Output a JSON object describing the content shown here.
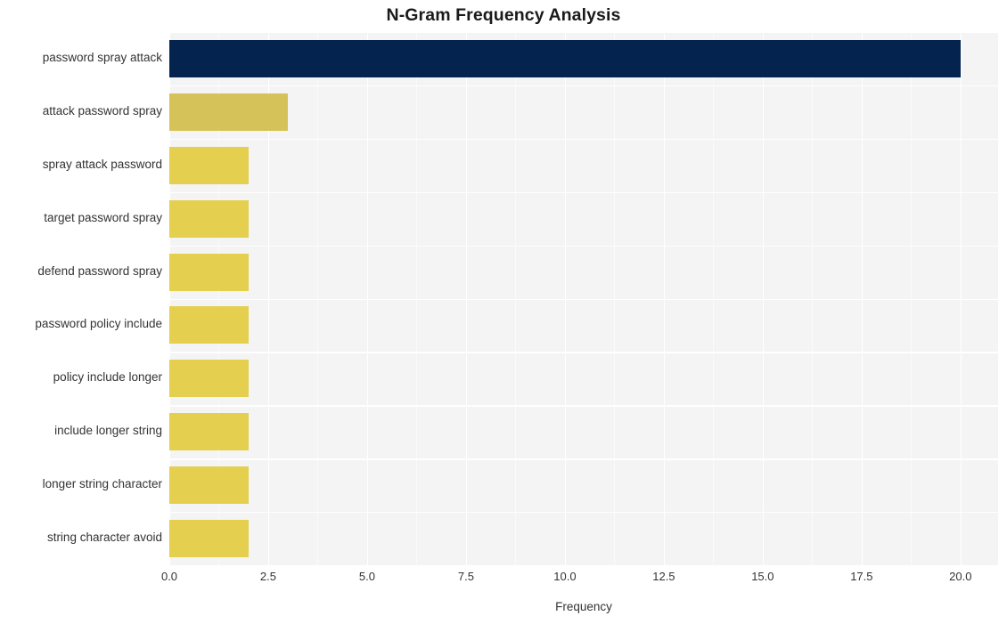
{
  "chart_data": {
    "type": "bar",
    "orientation": "horizontal",
    "title": "N-Gram Frequency Analysis",
    "xlabel": "Frequency",
    "ylabel": "",
    "categories": [
      "password spray attack",
      "attack password spray",
      "spray attack password",
      "target password spray",
      "defend password spray",
      "password policy include",
      "policy include longer",
      "include longer string",
      "longer string character",
      "string character avoid"
    ],
    "values": [
      20,
      3,
      2,
      2,
      2,
      2,
      2,
      2,
      2,
      2
    ],
    "bar_colors": [
      "#04244f",
      "#d5c359",
      "#e4cf4e",
      "#e4cf4e",
      "#e4cf4e",
      "#e4cf4e",
      "#e4cf4e",
      "#e4cf4e",
      "#e4cf4e",
      "#e4cf4e"
    ],
    "xlim": [
      0,
      20.95
    ],
    "xticks": [
      0,
      2.5,
      5,
      7.5,
      10,
      12.5,
      15,
      17.5,
      20
    ],
    "xtick_labels": [
      "0.0",
      "2.5",
      "5.0",
      "7.5",
      "10.0",
      "12.5",
      "15.0",
      "17.5",
      "20.0"
    ],
    "grid": true,
    "grid_color": "#ffffff",
    "legend": "none",
    "plot_background": "#f4f4f5",
    "figure_background": "#ffffff",
    "colormap": "cividis"
  }
}
